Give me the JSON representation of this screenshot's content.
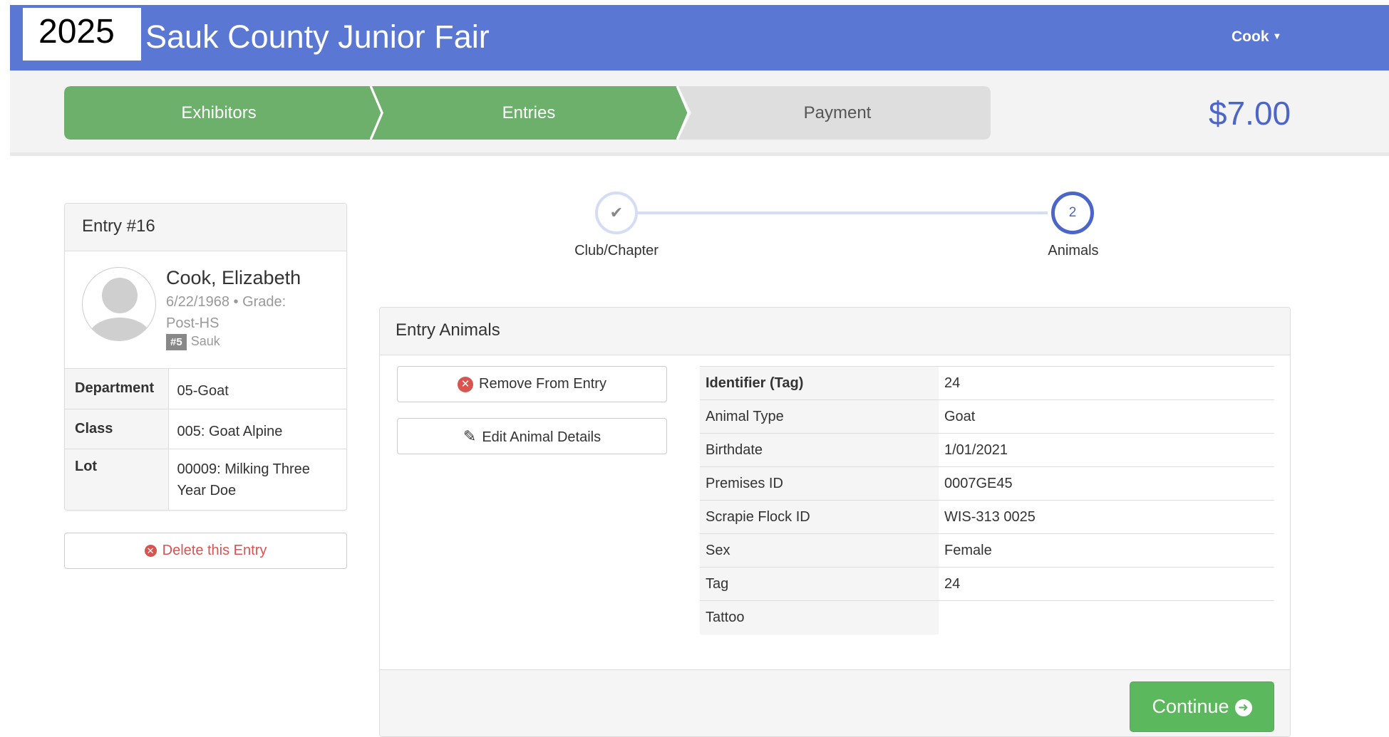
{
  "header": {
    "year": "2025",
    "title": "Sauk County Junior Fair",
    "user": "Cook"
  },
  "wizard": {
    "steps": [
      {
        "label": "Exhibitors",
        "state": "complete"
      },
      {
        "label": "Entries",
        "state": "current"
      },
      {
        "label": "Payment",
        "state": "pending"
      }
    ],
    "total": "$7.00"
  },
  "entry": {
    "title": "Entry #16",
    "name": "Cook, Elizabeth",
    "meta": "6/22/1968 • Grade: Post-HS",
    "club_number": "#5",
    "club_name": "Sauk",
    "fields": [
      {
        "label": "Department",
        "value": "05-Goat"
      },
      {
        "label": "Class",
        "value": "005: Goat Alpine"
      },
      {
        "label": "Lot",
        "value": "00009: Milking Three Year Doe"
      }
    ],
    "delete_label": "Delete this Entry"
  },
  "stepper": {
    "steps": [
      {
        "label": "Club/Chapter",
        "marker": "✔",
        "state": "done"
      },
      {
        "label": "Animals",
        "marker": "2",
        "state": "current"
      }
    ]
  },
  "animals_panel": {
    "title": "Entry Animals",
    "remove_label": "Remove From Entry",
    "edit_label": "Edit Animal Details",
    "details": [
      {
        "label": "Identifier (Tag)",
        "value": "24"
      },
      {
        "label": "Animal Type",
        "value": "Goat"
      },
      {
        "label": "Birthdate",
        "value": "1/01/2021"
      },
      {
        "label": "Premises ID",
        "value": "0007GE45"
      },
      {
        "label": "Scrapie Flock ID",
        "value": "WIS-313 0025"
      },
      {
        "label": "Sex",
        "value": "Female"
      },
      {
        "label": "Tag",
        "value": "24"
      },
      {
        "label": "Tattoo",
        "value": ""
      }
    ],
    "continue_label": "Continue"
  },
  "colors": {
    "header": "#5a77d4",
    "wizard_done": "#6cb06c",
    "wizard_pending": "#dedede",
    "accent": "#4b66c8",
    "danger": "#d9534f",
    "success": "#5cb85c"
  }
}
